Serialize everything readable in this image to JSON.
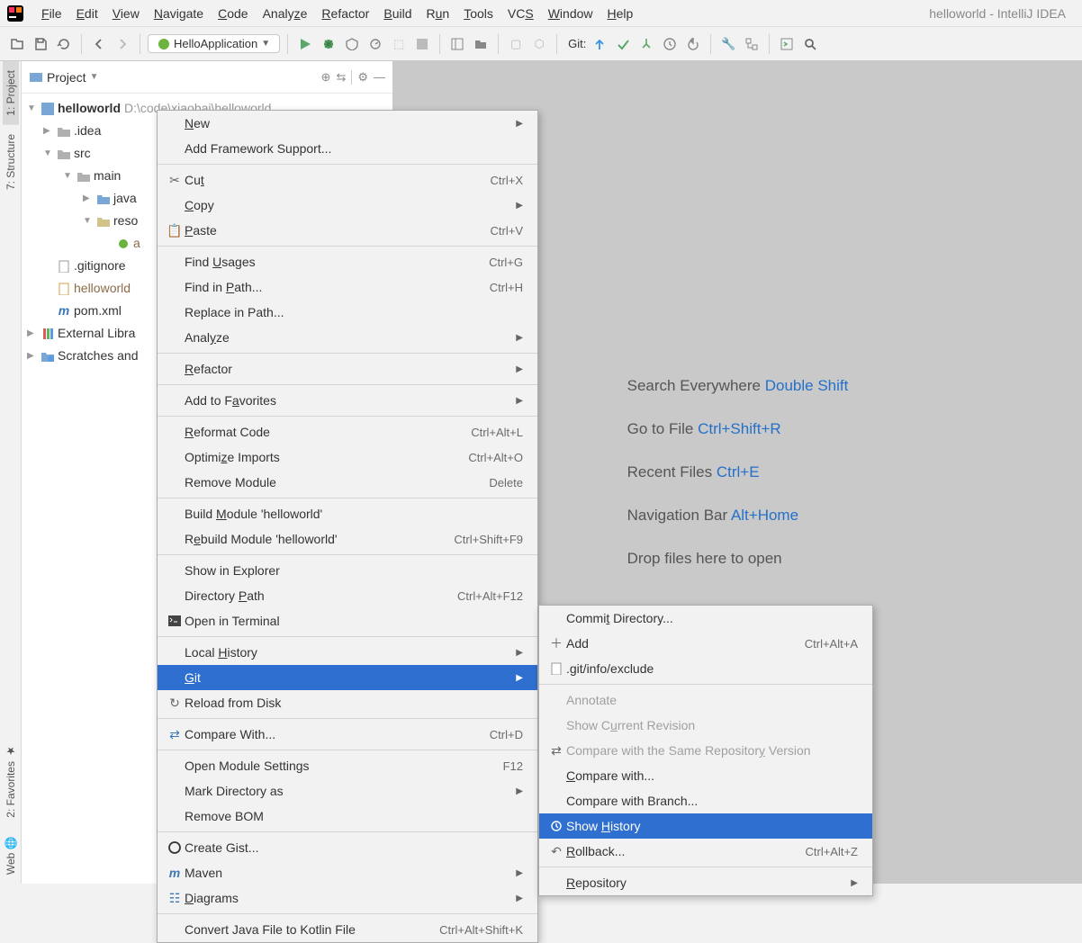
{
  "window_title": "helloworld - IntelliJ IDEA",
  "menubar": [
    "File",
    "Edit",
    "View",
    "Navigate",
    "Code",
    "Analyze",
    "Refactor",
    "Build",
    "Run",
    "Tools",
    "VCS",
    "Window",
    "Help"
  ],
  "run_config": "HelloApplication",
  "git_label": "Git:",
  "left_rail": {
    "favorites": "2: Favorites",
    "web": "Web",
    "structure": "7: Structure",
    "project": "1: Project"
  },
  "project_panel": {
    "title": "Project",
    "tree": {
      "root": "helloworld",
      "root_path": "D:\\code\\xiaobai\\helloworld",
      "idea": ".idea",
      "src": "src",
      "main": "main",
      "java": "java",
      "resources": "reso",
      "app": "a",
      "gitignore": ".gitignore",
      "iml": "helloworld",
      "pom": "pom.xml",
      "external": "External Libra",
      "scratches": "Scratches and"
    }
  },
  "hints": [
    {
      "label": "Search Everywhere ",
      "kbd": "Double Shift"
    },
    {
      "label": "Go to File ",
      "kbd": "Ctrl+Shift+R"
    },
    {
      "label": "Recent Files ",
      "kbd": "Ctrl+E"
    },
    {
      "label": "Navigation Bar ",
      "kbd": "Alt+Home"
    },
    {
      "label": "Drop files here to open",
      "kbd": ""
    }
  ],
  "ctx1": {
    "new": "New",
    "addfw": "Add Framework Support...",
    "cut": "Cut",
    "cut_sc": "Ctrl+X",
    "copy": "Copy",
    "paste": "Paste",
    "paste_sc": "Ctrl+V",
    "findusages": "Find Usages",
    "findusages_sc": "Ctrl+G",
    "findinpath": "Find in Path...",
    "findinpath_sc": "Ctrl+H",
    "replaceinpath": "Replace in Path...",
    "analyze": "Analyze",
    "refactor": "Refactor",
    "addtofav": "Add to Favorites",
    "reformat": "Reformat Code",
    "reformat_sc": "Ctrl+Alt+L",
    "optimize": "Optimize Imports",
    "optimize_sc": "Ctrl+Alt+O",
    "removemodule": "Remove Module",
    "removemodule_sc": "Delete",
    "buildmod": "Build Module 'helloworld'",
    "rebuildmod": "Rebuild Module 'helloworld'",
    "rebuildmod_sc": "Ctrl+Shift+F9",
    "showexp": "Show in Explorer",
    "dirpath": "Directory Path",
    "dirpath_sc": "Ctrl+Alt+F12",
    "openterm": "Open in Terminal",
    "localhist": "Local History",
    "git": "Git",
    "reload": "Reload from Disk",
    "compare": "Compare With...",
    "compare_sc": "Ctrl+D",
    "openmodset": "Open Module Settings",
    "openmodset_sc": "F12",
    "markdir": "Mark Directory as",
    "removebom": "Remove BOM",
    "creategist": "Create Gist...",
    "maven": "Maven",
    "diagrams": "Diagrams",
    "convertkotlin": "Convert Java File to Kotlin File",
    "convertkotlin_sc": "Ctrl+Alt+Shift+K"
  },
  "ctx2": {
    "commitdir": "Commit Directory...",
    "add": "Add",
    "add_sc": "Ctrl+Alt+A",
    "exclude": ".git/info/exclude",
    "annotate": "Annotate",
    "showcurrev": "Show Current Revision",
    "comparerepo": "Compare with the Same Repository Version",
    "comparewith": "Compare with...",
    "comparebranch": "Compare with Branch...",
    "showhistory": "Show History",
    "rollback": "Rollback...",
    "rollback_sc": "Ctrl+Alt+Z",
    "repository": "Repository"
  }
}
